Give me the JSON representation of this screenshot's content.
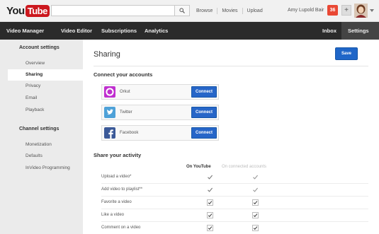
{
  "masthead": {
    "logo_you": "You",
    "logo_tube": "Tube",
    "search_placeholder": "",
    "links": [
      "Browse",
      "Movies",
      "Upload"
    ],
    "username": "Amy Lupold Bair",
    "notification_count": "36",
    "plus_label": "+"
  },
  "nav": {
    "items": [
      "Video Manager",
      "Video Editor",
      "Subscriptions",
      "Analytics"
    ],
    "right_items": [
      "Inbox",
      "Settings"
    ]
  },
  "sidebar": {
    "account_heading": "Account settings",
    "account_items": [
      "Overview",
      "Sharing",
      "Privacy",
      "Email",
      "Playback"
    ],
    "channel_heading": "Channel settings",
    "channel_items": [
      "Monetization",
      "Defaults",
      "InVideo Programming"
    ]
  },
  "main": {
    "title": "Sharing",
    "save_label": "Save",
    "connect_heading": "Connect your accounts",
    "accounts": [
      {
        "name": "Orkut",
        "button": "Connect",
        "color": "#c02fcf"
      },
      {
        "name": "Twitter",
        "button": "Connect",
        "color": "#4ea1d8"
      },
      {
        "name": "Facebook",
        "button": "Connect",
        "color": "#3b5998"
      }
    ],
    "activity_heading": "Share your activity",
    "col_on_youtube": "On YouTube",
    "col_connected": "On connected accounts",
    "activities": [
      {
        "label": "Upload a video*",
        "on_youtube": true,
        "connected": true
      },
      {
        "label": "Add video to playlist**",
        "on_youtube": true,
        "connected": true
      },
      {
        "label": "Favorite a video",
        "on_youtube": true,
        "connected": true
      },
      {
        "label": "Like a video",
        "on_youtube": true,
        "connected": true
      },
      {
        "label": "Comment on a video",
        "on_youtube": true,
        "connected": true
      }
    ]
  }
}
